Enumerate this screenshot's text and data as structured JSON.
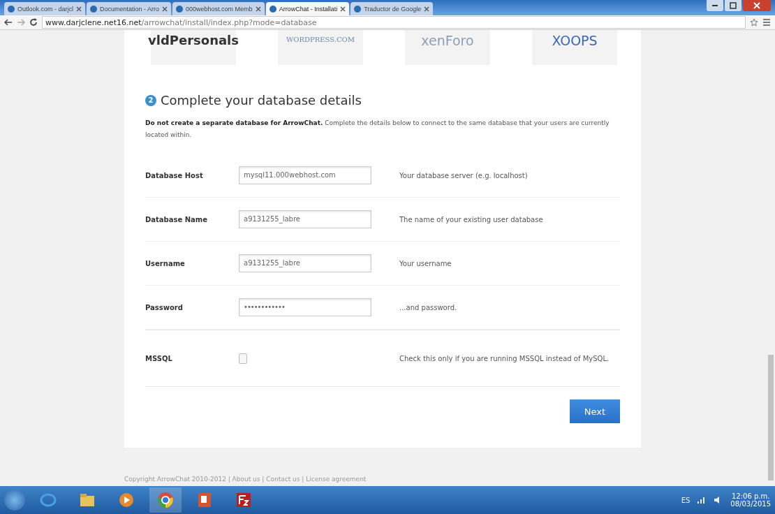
{
  "browser": {
    "tabs": [
      {
        "title": "Outlook.com - darjcl",
        "selected": false
      },
      {
        "title": "Documentation - Arro",
        "selected": false
      },
      {
        "title": "000webhost.com Memb",
        "selected": false
      },
      {
        "title": "ArrowChat - Installati",
        "selected": true
      },
      {
        "title": "Traductor de Google",
        "selected": false
      }
    ],
    "address": {
      "domain": "www.darjclene.net16.net",
      "path": "/arrowchat/install/index.php?mode=database"
    }
  },
  "logos": [
    "vldPersonals",
    "WORDPRESS.COM",
    "xenForo",
    "XOOPS"
  ],
  "step": {
    "number": "2",
    "title": "Complete your database details"
  },
  "intro": "**Do not create a separate database for ArrowChat.** Complete the details below to connect to the same database that your users are currently located within.",
  "fields": [
    {
      "kind": "text",
      "label": "Database Host",
      "value": "mysql11.000webhost.com",
      "hint": "Your database server (e.g. localhost)"
    },
    {
      "kind": "text",
      "label": "Database Name",
      "value": "a9131255_labre",
      "hint": "The name of your existing user database"
    },
    {
      "kind": "text",
      "label": "Username",
      "value": "a9131255_labre",
      "hint": "Your username"
    },
    {
      "kind": "password",
      "label": "Password",
      "value": "••••••••••••",
      "hint": "...and password."
    },
    {
      "kind": "checkbox",
      "label": "MSSQL",
      "checked": false,
      "hint": "Check this only if you are running MSSQL instead of MySQL."
    }
  ],
  "next_button": "Next",
  "footer": "Copyright ArrowChat 2010-2012 | About us | Contact us | License agreement",
  "taskbar": {
    "language": "ES",
    "time": "12:06 p.m.",
    "date": "08/03/2015"
  }
}
